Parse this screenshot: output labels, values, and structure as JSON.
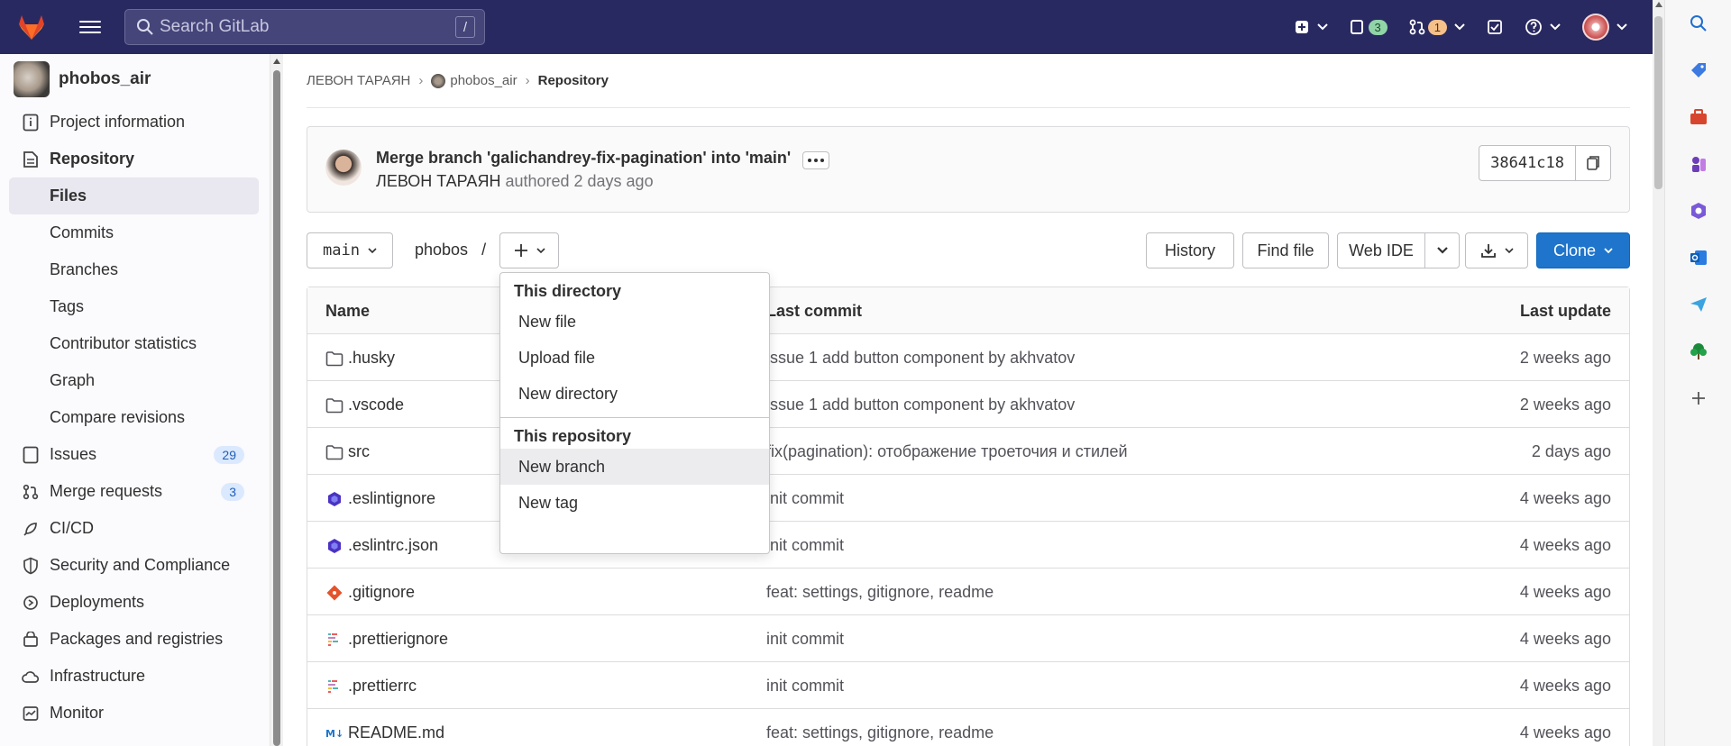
{
  "topbar": {
    "search_placeholder": "Search GitLab",
    "search_shortcut": "/",
    "issues_count": "3",
    "mr_count": "1"
  },
  "sidebar": {
    "project_name": "phobos_air",
    "items": [
      {
        "label": "Project information",
        "icon": "info-icon"
      },
      {
        "label": "Repository",
        "icon": "document-icon"
      },
      {
        "label": "Files"
      },
      {
        "label": "Commits"
      },
      {
        "label": "Branches"
      },
      {
        "label": "Tags"
      },
      {
        "label": "Contributor statistics"
      },
      {
        "label": "Graph"
      },
      {
        "label": "Compare revisions"
      },
      {
        "label": "Issues",
        "icon": "issues-icon",
        "count": "29"
      },
      {
        "label": "Merge requests",
        "icon": "merge-request-icon",
        "count": "3"
      },
      {
        "label": "CI/CD",
        "icon": "rocket-icon"
      },
      {
        "label": "Security and Compliance",
        "icon": "shield-icon"
      },
      {
        "label": "Deployments",
        "icon": "deployments-icon"
      },
      {
        "label": "Packages and registries",
        "icon": "package-icon"
      },
      {
        "label": "Infrastructure",
        "icon": "cloud-icon"
      },
      {
        "label": "Monitor",
        "icon": "monitor-icon"
      }
    ]
  },
  "breadcrumb": {
    "owner": "ЛЕВОН ТАРАЯН",
    "project": "phobos_air",
    "current": "Repository"
  },
  "commit": {
    "title": "Merge branch 'galichandrey-fix-pagination' into 'main'",
    "author": "ЛЕВОН ТАРАЯН",
    "authored_text": "authored 2 days ago",
    "sha": "38641c18"
  },
  "toolbar": {
    "branch": "main",
    "path": "phobos",
    "path_sep": "/",
    "history": "History",
    "find_file": "Find file",
    "web_ide": "Web IDE",
    "clone": "Clone"
  },
  "table": {
    "headers": {
      "name": "Name",
      "last_commit": "Last commit",
      "last_update": "Last update"
    },
    "rows": [
      {
        "name": ".husky",
        "type": "folder",
        "commit": "issue 1 add button component by akhvatov",
        "updated": "2 weeks ago"
      },
      {
        "name": ".vscode",
        "type": "folder",
        "commit": "issue 1 add button component by akhvatov",
        "updated": "2 weeks ago"
      },
      {
        "name": "src",
        "type": "folder",
        "commit": "fix(pagination): отображение троеточия и стилей",
        "updated": "2 days ago"
      },
      {
        "name": ".eslintignore",
        "type": "eslint",
        "commit": "init commit",
        "updated": "4 weeks ago"
      },
      {
        "name": ".eslintrc.json",
        "type": "eslint",
        "commit": "init commit",
        "updated": "4 weeks ago"
      },
      {
        "name": ".gitignore",
        "type": "git",
        "commit": "feat: settings, gitignore, readme",
        "updated": "4 weeks ago"
      },
      {
        "name": ".prettierignore",
        "type": "prettier",
        "commit": "init commit",
        "updated": "4 weeks ago"
      },
      {
        "name": ".prettierrc",
        "type": "prettier",
        "commit": "init commit",
        "updated": "4 weeks ago"
      },
      {
        "name": "README.md",
        "type": "markdown",
        "commit": "feat: settings, gitignore, readme",
        "updated": "4 weeks ago"
      }
    ]
  },
  "dropdown": {
    "section1": "This directory",
    "new_file": "New file",
    "upload_file": "Upload file",
    "new_directory": "New directory",
    "section2": "This repository",
    "new_branch": "New branch",
    "new_tag": "New tag"
  }
}
